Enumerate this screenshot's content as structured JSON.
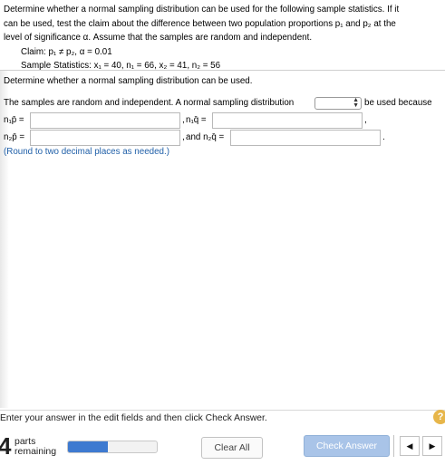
{
  "question": {
    "line1": "Determine whether a normal sampling distribution can be used for the following sample statistics. If it",
    "line2": "can be used, test the claim about the difference between two population proportions p₁ and p₂ at the",
    "line3": "level of significance α. Assume that the samples are random and independent.",
    "claim": "Claim: p₁ ≠ p₂, α = 0.01",
    "stats": "Sample Statistics: x₁ = 40, n₁ = 66, x₂ = 41, n₂ = 56"
  },
  "step": {
    "heading": "Determine whether a normal sampling distribution can be used.",
    "sentence_start": "The samples are random and independent. A normal sampling distribution",
    "select_value": "",
    "sentence_end": "be used because",
    "n1p_label": "n₁p̄ =",
    "n1q_label": "n₁q̄ =",
    "n2p_label": "n₂p̄ =",
    "n2q_label": "and n₂q̄ =",
    "n1p_value": "",
    "n1q_value": "",
    "n2p_value": "",
    "n2q_value": "",
    "hint": "(Round to two decimal places as needed.)"
  },
  "footer": {
    "instruction": "Enter your answer in the edit fields and then click Check Answer.",
    "help": "?",
    "parts_count": "4",
    "parts_label_1": "parts",
    "parts_label_2": "remaining",
    "progress_fraction": 0.45,
    "clear_label": "Clear All",
    "check_label": "Check Answer",
    "prev_icon": "◀",
    "next_icon": "▶"
  }
}
